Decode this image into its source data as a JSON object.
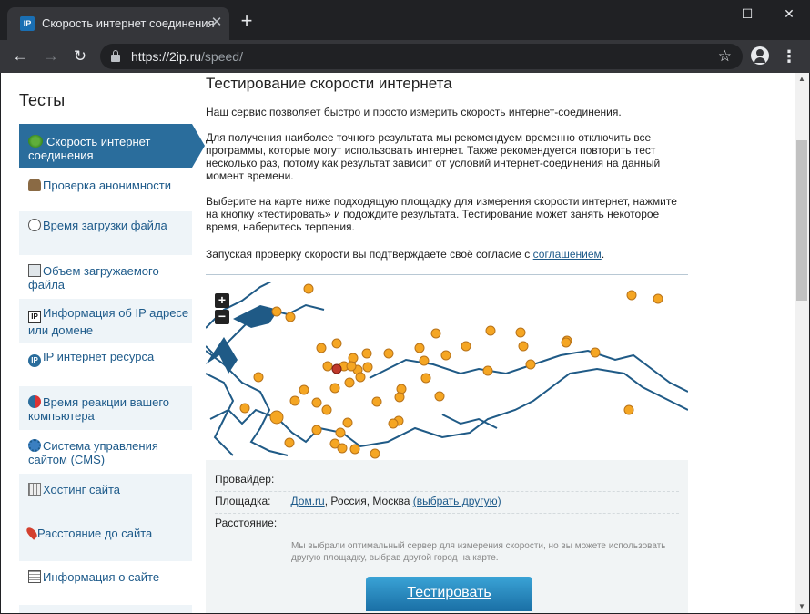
{
  "browser": {
    "tab_title": "Скорость интернет соединения",
    "favicon_text": "IP",
    "url_host": "https://2ip.ru",
    "url_path": "/speed/"
  },
  "sidebar": {
    "heading": "Тесты",
    "active_item": "Скорость интернет соединения",
    "items": [
      {
        "label": "Проверка анонимности",
        "icon": "person-icon"
      },
      {
        "label": "Время загрузки файла",
        "icon": "clock-icon"
      },
      {
        "label": "Объем загружаемого файла",
        "icon": "box-icon"
      },
      {
        "label": "Информация об IP адресе или домене",
        "icon": "ip-icon"
      },
      {
        "label": "IP интернет ресурса",
        "icon": "ip-circle-icon"
      },
      {
        "label": "Время реакции вашего компьютера",
        "icon": "reaction-icon"
      },
      {
        "label": "Система управления сайтом (CMS)",
        "icon": "gear-icon"
      },
      {
        "label": "Хостинг сайта",
        "icon": "hosting-icon"
      },
      {
        "label": "Расстояние до сайта",
        "icon": "pin-icon"
      },
      {
        "label": "Информация о сайте",
        "icon": "document-icon"
      }
    ]
  },
  "main": {
    "title": "Тестирование скорости интернета",
    "p1": "Наш сервис позволяет быстро и просто измерить скорость интернет-соединения.",
    "p2": "Для получения наиболее точного результата мы рекомендуем временно отключить все программы, которые могут использовать интернет. Также рекомендуется повторить тест несколько раз, потому как результат зависит от условий интернет-соединения на данный момент времени.",
    "p3": "Выберите на карте ниже подходящую площадку для измерения скорости интернет, нажмите на кнопку «тестировать» и подождите результата. Тестирование может занять некоторое время, наберитесь терпения.",
    "p4_prefix": "Запуская проверку скорости вы подтверждаете своё согласие с",
    "p4_link": "соглашением",
    "p4_suffix": "."
  },
  "map": {
    "zoom_in": "+",
    "zoom_out": "−"
  },
  "info": {
    "provider_label": "Провайдер:",
    "site_label": "Площадка:",
    "site_link": "Дом.ru",
    "site_text": ", Россия, Москва",
    "site_change": "(выбрать другую)",
    "distance_label": "Расстояние:",
    "note": "Мы выбрали оптимальный сервер для измерения скорости, но вы можете использовать другую площадку, выбрав другой город на карте.",
    "button": "Тестировать"
  }
}
